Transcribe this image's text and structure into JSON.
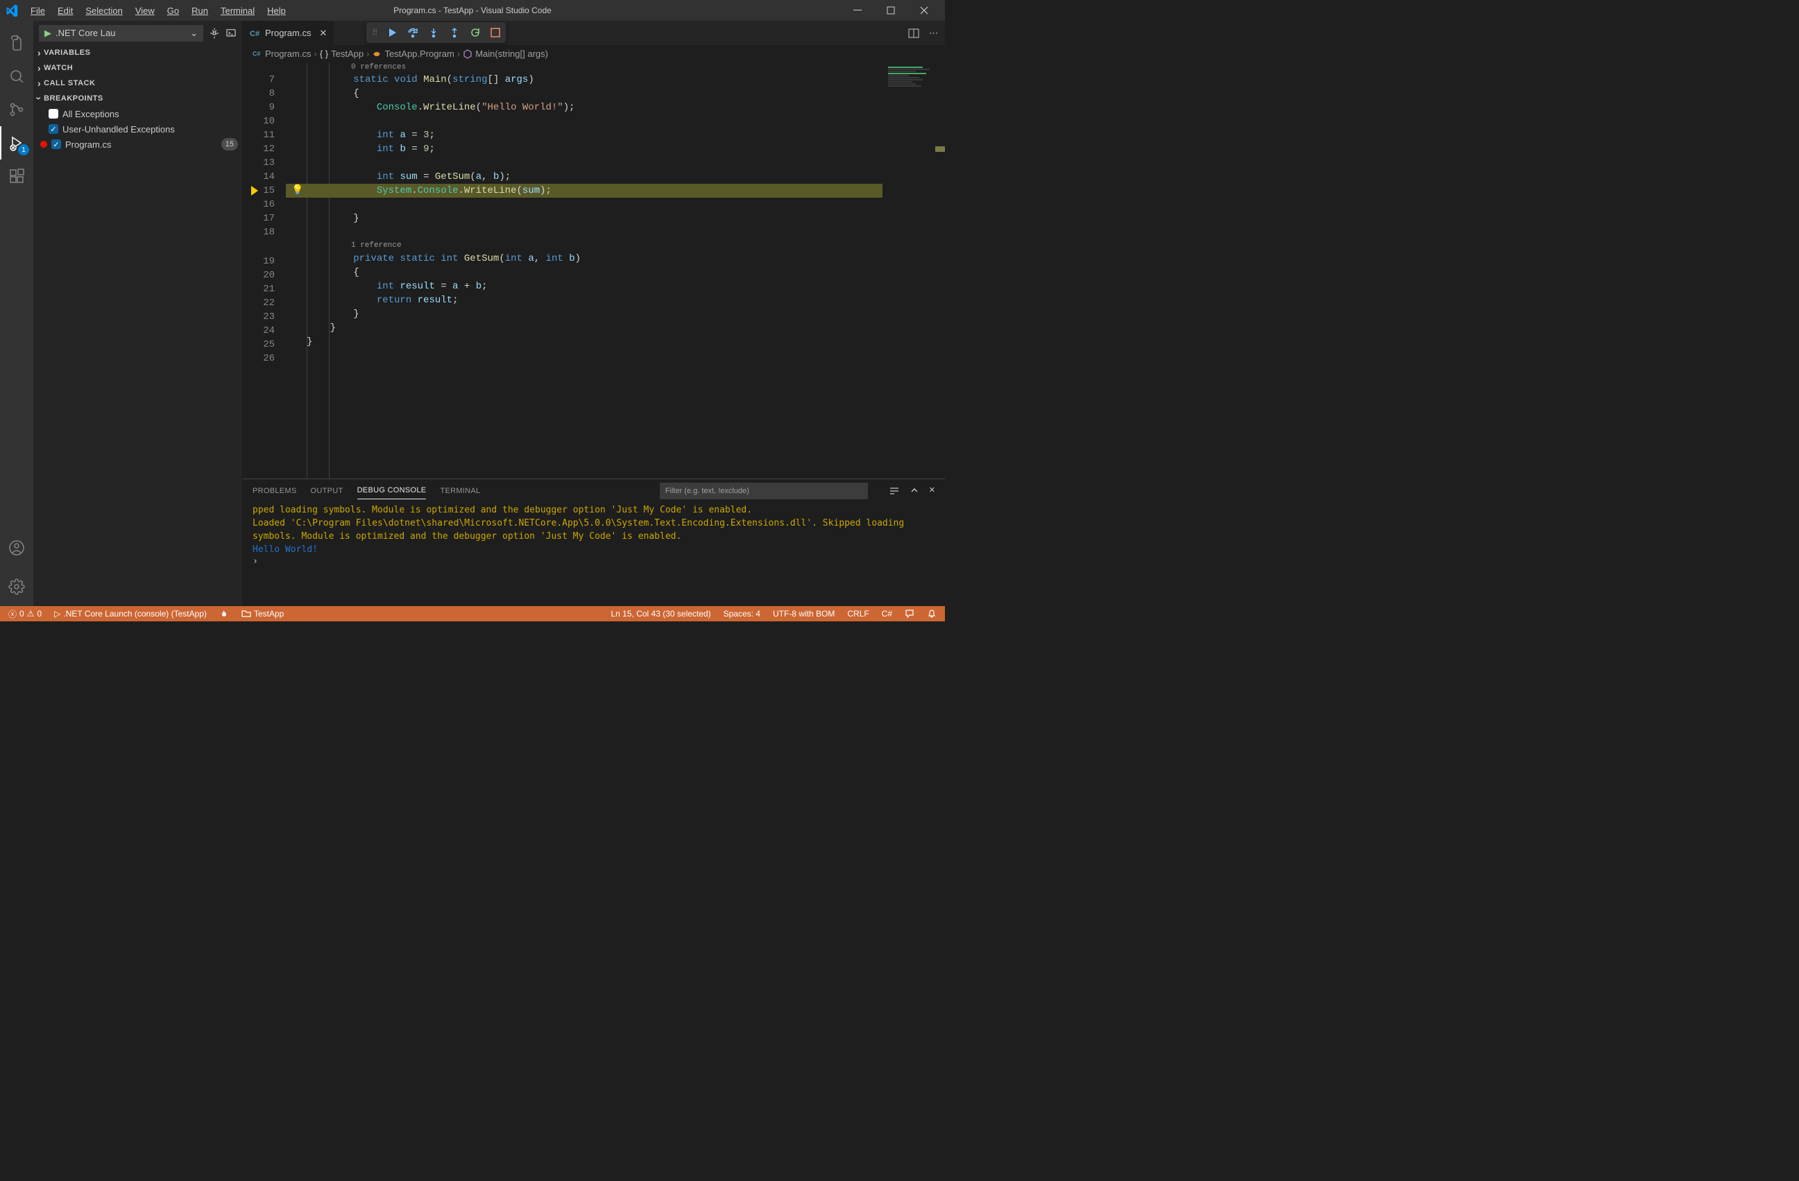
{
  "title": "Program.cs - TestApp - Visual Studio Code",
  "menu": [
    "File",
    "Edit",
    "Selection",
    "View",
    "Go",
    "Run",
    "Terminal",
    "Help"
  ],
  "activity": {
    "debug_badge": "1"
  },
  "sidebar": {
    "config": ".NET Core Lau",
    "sections": {
      "variables": "VARIABLES",
      "watch": "WATCH",
      "callstack": "CALL STACK",
      "breakpoints": "BREAKPOINTS"
    },
    "bp_all": "All Exceptions",
    "bp_user": "User-Unhandled Exceptions",
    "bp_file": "Program.cs",
    "bp_file_line": "15"
  },
  "tab": {
    "name": "Program.cs"
  },
  "breadcrumbs": {
    "file": "Program.cs",
    "ns": "TestApp",
    "cls": "TestApp.Program",
    "method": "Main(string[] args)"
  },
  "codelens": {
    "zero": "0 references",
    "one": "1 reference"
  },
  "code": {
    "l7a": "static",
    "l7b": "void",
    "l7c": "Main",
    "l7d": "string",
    "l7e": "args",
    "l9a": "Console",
    "l9b": "WriteLine",
    "l9c": "\"Hello World!\"",
    "l11a": "int",
    "l11b": "a",
    "l11c": "3",
    "l12a": "int",
    "l12b": "b",
    "l12c": "9",
    "l14a": "int",
    "l14b": "sum",
    "l14c": "GetSum",
    "l14d": "a",
    "l14e": "b",
    "l15a": "System",
    "l15b": "Console",
    "l15c": "WriteLine",
    "l15d": "sum",
    "l19a": "private",
    "l19b": "static",
    "l19c": "int",
    "l19d": "GetSum",
    "l19e": "int",
    "l19f": "a",
    "l19g": "int",
    "l19h": "b",
    "l21a": "int",
    "l21b": "result",
    "l21c": "a",
    "l21d": "b",
    "l22a": "return",
    "l22b": "result"
  },
  "line_numbers": [
    "7",
    "8",
    "9",
    "10",
    "11",
    "12",
    "13",
    "14",
    "15",
    "16",
    "17",
    "18",
    "19",
    "20",
    "21",
    "22",
    "23",
    "24",
    "25",
    "26"
  ],
  "panel": {
    "tabs": {
      "problems": "PROBLEMS",
      "output": "OUTPUT",
      "debug": "DEBUG CONSOLE",
      "terminal": "TERMINAL"
    },
    "filter_placeholder": "Filter (e.g. text, !exclude)",
    "out1": "pped loading symbols. Module is optimized and the debugger option 'Just My Code' is enabled.",
    "out2": "Loaded 'C:\\Program Files\\dotnet\\shared\\Microsoft.NETCore.App\\5.0.0\\System.Text.Encoding.Extensions.dll'. Skipped loading symbols. Module is optimized and the debugger option 'Just My Code' is enabled.",
    "hello": "Hello World!"
  },
  "status": {
    "errors": "0",
    "warnings": "0",
    "launch": ".NET Core Launch (console) (TestApp)",
    "folder": "TestApp",
    "lncol": "Ln 15, Col 43 (30 selected)",
    "spaces": "Spaces: 4",
    "encoding": "UTF-8 with BOM",
    "eol": "CRLF",
    "lang": "C#"
  }
}
